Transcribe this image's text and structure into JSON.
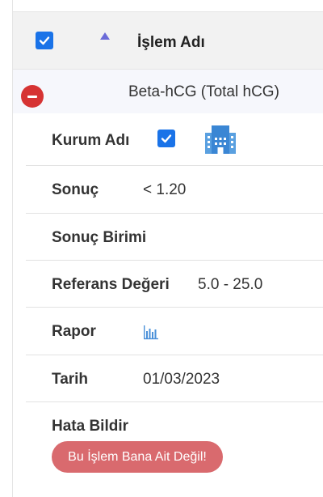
{
  "header": {
    "title": "İşlem Adı"
  },
  "item": {
    "name": "Beta-hCG (Total hCG)"
  },
  "details": {
    "institution_label": "Kurum Adı",
    "result_label": "Sonuç",
    "result_value": "< 1.20",
    "unit_label": "Sonuç Birimi",
    "reference_label": "Referans Değeri",
    "reference_value": "5.0 - 25.0",
    "report_label": "Rapor",
    "date_label": "Tarih",
    "date_value": "01/03/2023",
    "error_label": "Hata Bildir"
  },
  "buttons": {
    "report_error": "Bu İşlem Bana Ait Değil!"
  },
  "colors": {
    "accent": "#1a73e8",
    "danger": "#d63333",
    "report_button": "#d96a6e",
    "sort": "#6b6bd8"
  }
}
